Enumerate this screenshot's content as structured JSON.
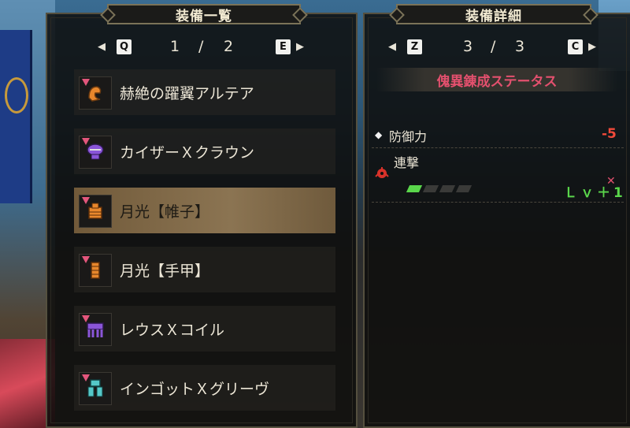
{
  "left_panel": {
    "title": "装備一覧",
    "pager": {
      "prev_key": "Q",
      "next_key": "E",
      "current": "1",
      "sep": "/",
      "total": "2"
    },
    "items": [
      {
        "name": "赫絶の躍翼アルテア",
        "icon": "helm-icon",
        "icon_color": "#e8872c"
      },
      {
        "name": "カイザーＸクラウン",
        "icon": "crown-icon",
        "icon_color": "#8a55d8"
      },
      {
        "name": "月光【帷子】",
        "icon": "chest-armor-icon",
        "icon_color": "#e8872c"
      },
      {
        "name": "月光【手甲】",
        "icon": "gauntlet-icon",
        "icon_color": "#e8872c"
      },
      {
        "name": "レウスＸコイル",
        "icon": "waist-armor-icon",
        "icon_color": "#8a55d8"
      },
      {
        "name": "インゴットＸグリーヴ",
        "icon": "leg-armor-icon",
        "icon_color": "#55c8c8"
      }
    ],
    "selected_index": 2
  },
  "right_panel": {
    "title": "装備詳細",
    "pager": {
      "prev_key": "Z",
      "next_key": "C",
      "current": "3",
      "sep": "/",
      "total": "3"
    },
    "header": "傀異錬成ステータス",
    "defense_label": "防御力",
    "defense_value": "-5",
    "skill_name": "連撃",
    "skill_level_text": "Ｌｖ＋1",
    "skill_level_fill": 1,
    "skill_level_max": 4
  },
  "colors": {
    "accent_red": "#e3506e",
    "level_green": "#5ad64b",
    "negative": "#f04a3a"
  }
}
